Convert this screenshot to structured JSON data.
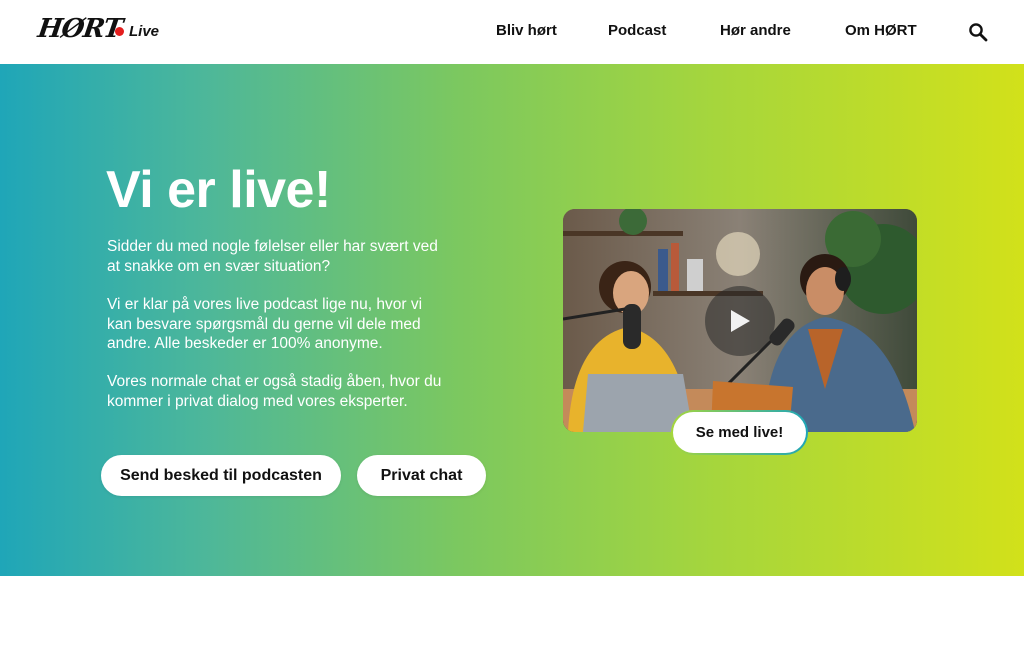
{
  "header": {
    "logo": "HØRT",
    "live_label": "Live",
    "nav": [
      "Bliv hørt",
      "Podcast",
      "Hør andre",
      "Om HØRT"
    ],
    "search_icon": "search-icon"
  },
  "hero": {
    "title": "Vi er live!",
    "paragraphs": [
      "Sidder du med nogle følelser eller har svært ved at snakke om en svær situation?",
      "Vi er klar på vores live podcast lige nu, hvor vi kan besvare spørgsmål du gerne vil dele med andre. Alle beskeder er 100% anonyme.",
      "Vores normale chat er også stadig åben, hvor du kommer i privat dialog med vores eksperter."
    ],
    "buttons": {
      "send": "Send besked til podcasten",
      "private": "Privat chat"
    },
    "video": {
      "play_icon": "play-icon",
      "cta": "Se med live!"
    }
  },
  "colors": {
    "gradient_start": "#1fa6b8",
    "gradient_end": "#d2e11a",
    "live_dot": "#e41e1e"
  }
}
